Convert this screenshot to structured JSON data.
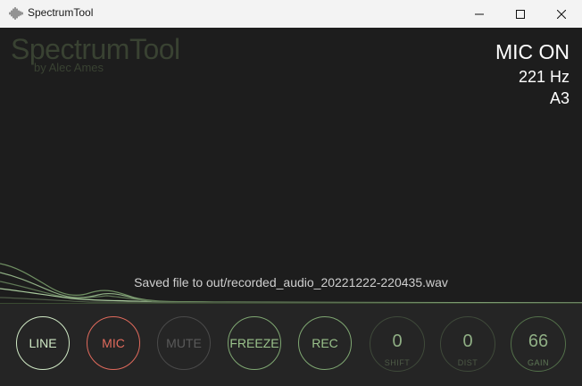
{
  "window": {
    "title": "SpectrumTool",
    "icon": "waveform-icon",
    "controls": [
      "minimize-icon",
      "maximize-icon",
      "close-icon"
    ]
  },
  "branding": {
    "app_name": "SpectrumTool",
    "author": "by Alec Ames",
    "color": "#394232"
  },
  "status": {
    "mic": "MIC ON",
    "frequency": "221 Hz",
    "note": "A3"
  },
  "message": "Saved file to out/recorded_audio_20221222-220435.wav",
  "buttons": {
    "line": "LINE",
    "mic": "MIC",
    "mute": "MUTE",
    "freeze": "FREEZE",
    "rec": "REC"
  },
  "knobs": {
    "shift": {
      "value": "0",
      "label": "SHIFT"
    },
    "dist": {
      "value": "0",
      "label": "DIST"
    },
    "gain": {
      "value": "66",
      "label": "GAIN"
    }
  },
  "colors": {
    "background": "#1d1d1d",
    "panel": "#252525",
    "accent_green": "#9ac28b",
    "mic_red": "#e06a5c",
    "line_light": "#cfe8c4"
  }
}
